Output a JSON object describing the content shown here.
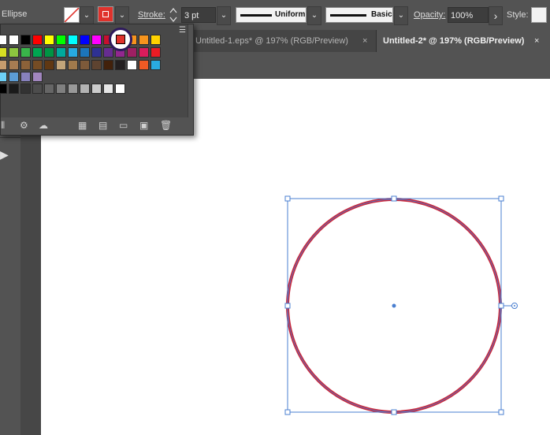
{
  "control_bar": {
    "object_label": "Ellipse",
    "stroke_label": "Stroke:",
    "stroke_weight": "3 pt",
    "profile_uniform": "Uniform",
    "brush_basic": "Basic",
    "opacity_label": "Opacity:",
    "opacity_value": "100%",
    "style_label": "Style:"
  },
  "tabs": [
    {
      "label": "Untitled-1.eps* @ 197% (RGB/Preview)",
      "close": "×"
    },
    {
      "label": "Untitled-2* @ 197% (RGB/Preview)",
      "close": "×"
    }
  ],
  "icons": {
    "chevron": "⌄",
    "play": "▶",
    "menu": "☰",
    "arrow_right": "›"
  },
  "colors": {
    "ellipse_stroke": "#c9283c",
    "selection": "#4a7fd0",
    "stroke_swatch": "#e0322c"
  },
  "swatch_rows": [
    [
      "#ffffff",
      "#ffffff",
      "#000000",
      "#ff0000",
      "#ffff00",
      "#00ff00",
      "#00ffff",
      "#0000ff",
      "#ff00ff",
      "#c8102e",
      "#e0322c",
      "#f7941d",
      "#f7941d",
      "#ffd200"
    ],
    [
      "#d7df23",
      "#8dc63f",
      "#39b54a",
      "#00a651",
      "#009444",
      "#00a99d",
      "#27aae1",
      "#1c75bc",
      "#2e3192",
      "#662d91",
      "#92278f",
      "#9e1f63",
      "#da1c5c",
      "#ed1c24"
    ],
    [
      "#c69c6d",
      "#a67c52",
      "#8c6239",
      "#754c24",
      "#603813",
      "#c2a57a",
      "#a07a4c",
      "#7d5a3a",
      "#5e4330",
      "#42210b",
      "#231f20",
      "#ffffff",
      "#f15a24",
      "#29abe2"
    ],
    [
      "#6dcff6",
      "#5c9dd6",
      "#8781bd",
      "#a186be"
    ],
    [
      "#000000",
      "#1a1a1a",
      "#333333",
      "#4d4d4d",
      "#666666",
      "#808080",
      "#999999",
      "#b3b3b3",
      "#cccccc",
      "#e6e6e6",
      "#ffffff"
    ]
  ]
}
